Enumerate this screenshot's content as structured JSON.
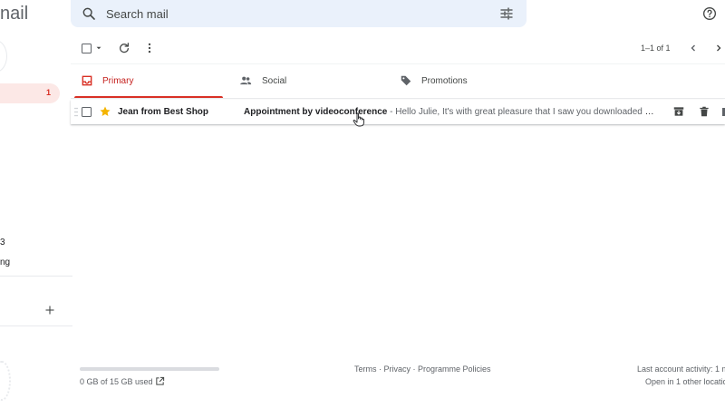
{
  "app": {
    "title_fragment": "nail"
  },
  "search": {
    "placeholder": "Search mail"
  },
  "nav": {
    "inbox_count": "1",
    "fragment_1": "3",
    "fragment_2": "ng"
  },
  "toolbar": {
    "pager": "1–1 of 1"
  },
  "tabs": [
    {
      "label": "Primary",
      "icon": "inbox-icon",
      "active": true
    },
    {
      "label": "Social",
      "icon": "people-icon",
      "active": false
    },
    {
      "label": "Promotions",
      "icon": "tag-icon",
      "active": false
    }
  ],
  "emails": [
    {
      "sender": "Jean from Best Shop",
      "subject": "Appointment by videoconference",
      "separator": " - ",
      "preview": "Hello Julie, It's with great pleasure that I saw you downloaded our ...",
      "starred": true
    }
  ],
  "footer": {
    "storage_used": "0 GB of 15 GB used",
    "storage_fraction": 0.0,
    "links": [
      "Terms",
      "Privacy",
      "Programme Policies"
    ],
    "link_sep": " · ",
    "activity_line_1": "Last account activity: 1 m",
    "activity_line_2": "Open in 1 other locatio"
  },
  "colors": {
    "accent_red": "#d93025",
    "star_yellow": "#f4b400",
    "search_bg": "#eaf1fb",
    "inbox_highlight": "#fce8e6"
  }
}
